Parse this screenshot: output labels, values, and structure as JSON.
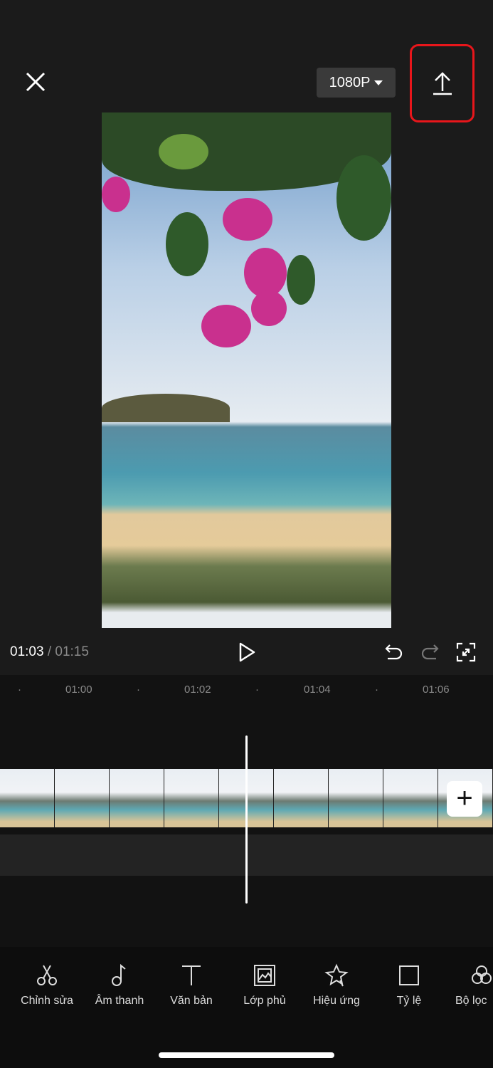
{
  "header": {
    "close_icon": "close-icon",
    "resolution": "1080P",
    "export_icon": "upload-icon",
    "highlight_color": "#e8161b"
  },
  "player": {
    "current_time": "01:03",
    "separator": "/",
    "total_time": "01:15"
  },
  "ruler": {
    "ticks": [
      "01:00",
      "01:02",
      "01:04",
      "01:06"
    ]
  },
  "toolbar": {
    "items": [
      {
        "label": "Chỉnh sửa",
        "icon": "scissors-icon"
      },
      {
        "label": "Âm thanh",
        "icon": "music-note-icon"
      },
      {
        "label": "Văn bản",
        "icon": "text-icon"
      },
      {
        "label": "Lớp phủ",
        "icon": "overlay-icon"
      },
      {
        "label": "Hiệu ứng",
        "icon": "star-effect-icon"
      },
      {
        "label": "Tỷ lệ",
        "icon": "ratio-icon"
      },
      {
        "label": "Bộ lọc",
        "icon": "filter-icon"
      }
    ]
  }
}
